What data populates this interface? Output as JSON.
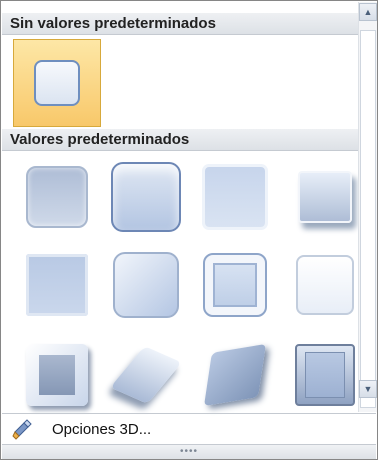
{
  "sections": {
    "no_presets": "Sin valores predeterminados",
    "presets": "Valores predeterminados"
  },
  "footer": {
    "options_label": "Opciones 3D...",
    "icon": "3d-options-icon"
  },
  "scrollbar": {
    "up_icon": "scroll-up-arrow-icon",
    "down_icon": "scroll-down-arrow-icon",
    "up_glyph": "▲",
    "down_glyph": "▼"
  },
  "grip": {
    "glyph": "••••"
  },
  "colors": {
    "selected_fill": "#f8c86a",
    "shape_blue": "#b9c9e3",
    "shape_border": "#7f97bf"
  }
}
